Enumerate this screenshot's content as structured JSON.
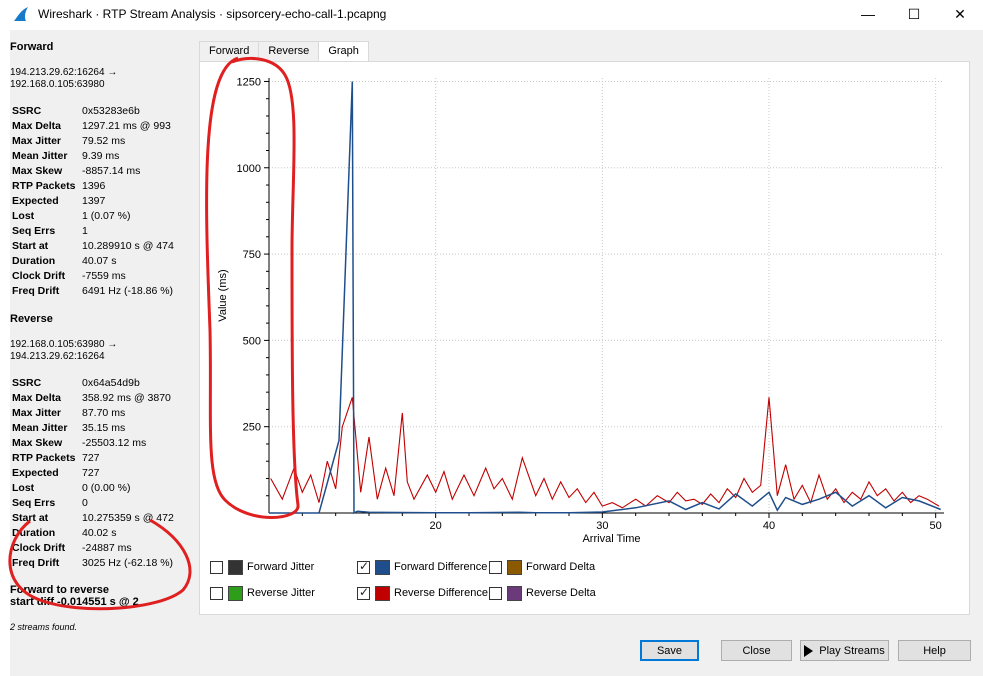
{
  "window": {
    "title": "Wireshark · RTP Stream Analysis · sipsorcery-echo-call-1.pcapng",
    "icon": "wireshark-fin-icon",
    "controls": {
      "minimize": "—",
      "maximize": "☐",
      "close": "✕"
    }
  },
  "forward": {
    "heading": "Forward",
    "address": "194.213.29.62:16264 →\n192.168.0.105:63980",
    "stats": [
      {
        "label": "SSRC",
        "value": "0x53283e6b"
      },
      {
        "label": "Max Delta",
        "value": "1297.21 ms @ 993"
      },
      {
        "label": "Max Jitter",
        "value": "79.52 ms"
      },
      {
        "label": "Mean Jitter",
        "value": "9.39 ms"
      },
      {
        "label": "Max Skew",
        "value": "-8857.14 ms"
      },
      {
        "label": "RTP Packets",
        "value": "1396"
      },
      {
        "label": "Expected",
        "value": "1397"
      },
      {
        "label": "Lost",
        "value": "1 (0.07 %)"
      },
      {
        "label": "Seq Errs",
        "value": "1"
      },
      {
        "label": "Start at",
        "value": "10.289910 s @ 474"
      },
      {
        "label": "Duration",
        "value": "40.07 s"
      },
      {
        "label": "Clock Drift",
        "value": "-7559 ms"
      },
      {
        "label": "Freq Drift",
        "value": "6491 Hz (-18.86 %)"
      }
    ]
  },
  "reverse": {
    "heading": "Reverse",
    "address": "192.168.0.105:63980 →\n194.213.29.62:16264",
    "stats": [
      {
        "label": "SSRC",
        "value": "0x64a54d9b"
      },
      {
        "label": "Max Delta",
        "value": "358.92 ms @ 3870"
      },
      {
        "label": "Max Jitter",
        "value": "87.70 ms"
      },
      {
        "label": "Mean Jitter",
        "value": "35.15 ms"
      },
      {
        "label": "Max Skew",
        "value": "-25503.12 ms"
      },
      {
        "label": "RTP Packets",
        "value": "727"
      },
      {
        "label": "Expected",
        "value": "727"
      },
      {
        "label": "Lost",
        "value": "0 (0.00 %)"
      },
      {
        "label": "Seq Errs",
        "value": "0"
      },
      {
        "label": "Start at",
        "value": "10.275359 s @ 472"
      },
      {
        "label": "Duration",
        "value": "40.02 s"
      },
      {
        "label": "Clock Drift",
        "value": "-24887 ms"
      },
      {
        "label": "Freq Drift",
        "value": "3025 Hz (-62.18 %)"
      }
    ]
  },
  "summary": {
    "f2r_line1": "Forward to reverse",
    "f2r_line2": "start diff -0.014551 s @ 2",
    "streams_found": "2 streams found."
  },
  "tabs": [
    {
      "label": "Forward",
      "active": false
    },
    {
      "label": "Reverse",
      "active": false
    },
    {
      "label": "Graph",
      "active": true
    }
  ],
  "legend": [
    {
      "label": "Forward Jitter",
      "checked": false,
      "color": "#333333"
    },
    {
      "label": "Forward Difference",
      "checked": true,
      "color": "#1f4e8c"
    },
    {
      "label": "Forward Delta",
      "checked": false,
      "color": "#8b5a00"
    },
    {
      "label": "Reverse Jitter",
      "checked": false,
      "color": "#2e9e1a"
    },
    {
      "label": "Reverse Difference",
      "checked": true,
      "color": "#c00000"
    },
    {
      "label": "Reverse Delta",
      "checked": false,
      "color": "#6b3a7a"
    }
  ],
  "buttons": {
    "save": "Save",
    "close": "Close",
    "play": "Play Streams",
    "help": "Help"
  },
  "chart_data": {
    "type": "line",
    "title": "",
    "xlabel": "Arrival Time",
    "ylabel": "Value (ms)",
    "xlim": [
      10,
      50.5
    ],
    "ylim": [
      0,
      1260
    ],
    "xticks": [
      20,
      30,
      40,
      50
    ],
    "yticks": [
      250,
      500,
      750,
      1000,
      1250
    ],
    "grid": true,
    "legend": "none",
    "series": [
      {
        "name": "Forward Difference",
        "color": "#1f4e8c",
        "x": [
          10,
          13,
          14.2,
          15,
          15.1,
          15.3,
          16,
          20,
          22,
          25,
          26,
          28,
          30,
          32,
          34,
          35,
          36,
          37,
          38,
          39,
          40,
          40.5,
          41,
          42,
          43,
          44,
          45,
          46,
          47,
          48,
          49,
          50.3
        ],
        "y": [
          0,
          0,
          210,
          1250,
          0,
          5,
          2,
          1,
          1,
          2,
          1,
          1,
          3,
          15,
          35,
          10,
          30,
          12,
          55,
          20,
          60,
          8,
          45,
          25,
          40,
          60,
          20,
          50,
          15,
          45,
          35,
          10
        ]
      },
      {
        "name": "Reverse Difference",
        "color": "#c00000",
        "x": [
          10.1,
          10.8,
          11.5,
          12,
          12.5,
          13,
          13.5,
          14,
          14.4,
          15,
          15.5,
          16,
          16.5,
          17,
          17.5,
          18,
          18.3,
          18.7,
          19.5,
          20,
          20.5,
          21,
          21.7,
          22.3,
          23,
          23.5,
          24,
          24.6,
          25.2,
          26,
          26.5,
          27,
          27.5,
          28,
          28.5,
          29,
          29.5,
          30,
          30.6,
          31.2,
          32,
          32.6,
          33.3,
          34,
          34.5,
          35,
          35.5,
          36,
          36.5,
          37,
          37.5,
          38,
          38.5,
          39,
          39.5,
          40,
          40.5,
          41,
          41.5,
          42,
          42.5,
          43,
          43.5,
          44,
          44.5,
          45,
          45.5,
          46,
          46.5,
          47,
          47.5,
          48,
          48.5,
          49,
          49.5,
          50.2
        ],
        "y": [
          100,
          40,
          130,
          60,
          110,
          30,
          150,
          70,
          250,
          335,
          60,
          220,
          40,
          130,
          50,
          290,
          90,
          40,
          110,
          60,
          120,
          40,
          110,
          50,
          130,
          70,
          100,
          40,
          160,
          50,
          100,
          40,
          90,
          45,
          70,
          30,
          60,
          20,
          30,
          15,
          40,
          20,
          50,
          30,
          60,
          35,
          40,
          25,
          55,
          30,
          70,
          45,
          100,
          60,
          80,
          335,
          50,
          140,
          40,
          80,
          30,
          110,
          40,
          70,
          30,
          60,
          40,
          90,
          50,
          70,
          35,
          60,
          30,
          50,
          40,
          20
        ]
      }
    ]
  }
}
